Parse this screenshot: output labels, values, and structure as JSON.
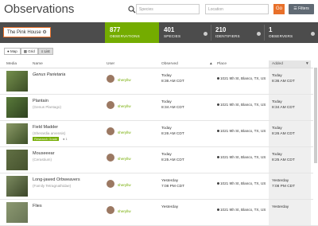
{
  "header": {
    "title": "Observations",
    "search_placeholder": "Species",
    "location_placeholder": "Location",
    "go_label": "Go",
    "filters_label": "Filters"
  },
  "stats": {
    "place": "The Pink House",
    "observations": {
      "value": "877",
      "label": "OBSERVATIONS"
    },
    "species": {
      "value": "401",
      "label": "SPECIES"
    },
    "identifiers": {
      "value": "210",
      "label": "IDENTIFIERS"
    },
    "observers": {
      "value": "1",
      "label": "OBSERVERS"
    }
  },
  "view": {
    "map": "Map",
    "grid": "Grid",
    "list": "List",
    "active": "list"
  },
  "columns": [
    "Media",
    "Name",
    "User",
    "Observed",
    "Place",
    "Added"
  ],
  "rows": [
    {
      "name": "Genus Parietaria",
      "sub": "",
      "badge": "",
      "badge_count": "",
      "user": "sheryllw",
      "observed_day": "Today",
      "observed_time": "8:36 AM CDT",
      "place": "1021 9th St, Blanco, TX, US",
      "added_day": "Today",
      "added_time": "8:36 AM CDT"
    },
    {
      "name": "Plantain",
      "sub": "(Genus Plantago)",
      "badge": "",
      "badge_count": "",
      "user": "sheryllw",
      "observed_day": "Today",
      "observed_time": "8:34 AM CDT",
      "place": "1021 9th St, Blanco, TX, US",
      "added_day": "Today",
      "added_time": "8:34 AM CDT"
    },
    {
      "name": "Field Madder",
      "sub": "(Sherardia arvensis)",
      "badge": "Research Grade",
      "badge_count": "1",
      "user": "sheryllw",
      "observed_day": "Today",
      "observed_time": "8:26 AM CDT",
      "place": "1021 9th St, Blanco, TX, US",
      "added_day": "Today",
      "added_time": "8:26 AM CDT"
    },
    {
      "name": "Mouseeear",
      "sub": "(Cerastium)",
      "badge": "",
      "badge_count": "",
      "user": "sheryllw",
      "observed_day": "Today",
      "observed_time": "8:25 AM CDT",
      "place": "1021 9th St, Blanco, TX, US",
      "added_day": "Today",
      "added_time": "8:25 AM CDT"
    },
    {
      "name": "Long-jawed Orbweavers",
      "sub": "(Family Tetragnathidae)",
      "badge": "",
      "badge_count": "",
      "user": "sheryllw",
      "observed_day": "Yesterday",
      "observed_time": "7:08 PM CDT",
      "place": "1021 9th St, Blanco, TX, US",
      "added_day": "Yesterday",
      "added_time": "7:08 PM CDT"
    },
    {
      "name": "Flies",
      "sub": "",
      "badge": "",
      "badge_count": "",
      "user": "sheryllw",
      "observed_day": "Yesterday",
      "observed_time": "",
      "place": "1021 9th St, Blanco, TX, US",
      "added_day": "Yesterday",
      "added_time": ""
    }
  ]
}
